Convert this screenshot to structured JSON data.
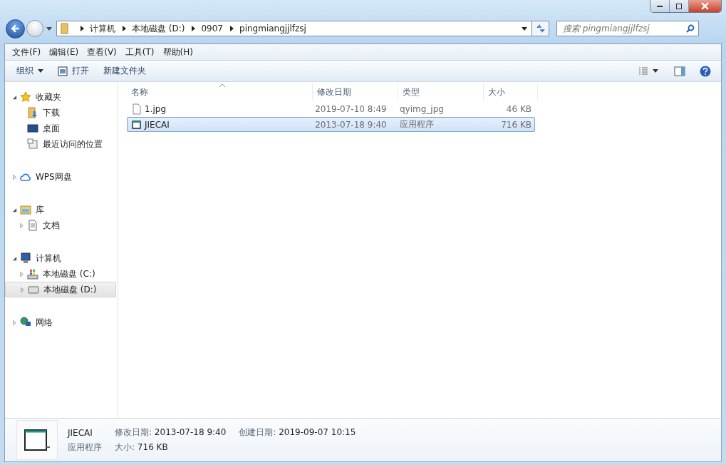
{
  "address": {
    "crumbs": [
      "计算机",
      "本地磁盘 (D:)",
      "0907",
      "pingmiangjjlfzsj"
    ]
  },
  "search": {
    "placeholder": "搜索 pingmiangjjlfzsj"
  },
  "menu": [
    "文件(F)",
    "编辑(E)",
    "查看(V)",
    "工具(T)",
    "帮助(H)"
  ],
  "toolbar": {
    "organize": "组织",
    "open": "打开",
    "new_folder": "新建文件夹"
  },
  "sidebar": {
    "items": [
      {
        "label": "收藏夹",
        "kind": "star",
        "expanded": true,
        "selected": false,
        "children": [
          {
            "label": "下载",
            "kind": "download",
            "selected": false
          },
          {
            "label": "桌面",
            "kind": "desktop",
            "selected": false
          },
          {
            "label": "最近访问的位置",
            "kind": "recent",
            "selected": false
          }
        ]
      },
      {
        "label": "WPS网盘",
        "kind": "cloud",
        "expanded": false,
        "selected": false
      },
      {
        "label": "库",
        "kind": "library",
        "expanded": true,
        "selected": false,
        "children": [
          {
            "label": "文档",
            "kind": "document",
            "expanded": false,
            "selected": false
          }
        ]
      },
      {
        "label": "计算机",
        "kind": "computer",
        "expanded": true,
        "selected": false,
        "children": [
          {
            "label": "本地磁盘 (C:)",
            "kind": "system-drive",
            "expanded": false,
            "selected": false
          },
          {
            "label": "本地磁盘 (D:)",
            "kind": "drive",
            "expanded": false,
            "selected": true
          }
        ]
      },
      {
        "label": "网络",
        "kind": "network",
        "expanded": false,
        "selected": false
      }
    ]
  },
  "table": {
    "columns": [
      {
        "label": "名称",
        "sorted": true
      },
      {
        "label": "修改日期",
        "sorted": false
      },
      {
        "label": "类型",
        "sorted": false
      },
      {
        "label": "大小",
        "sorted": false
      }
    ],
    "rows": [
      {
        "name": "1.jpg",
        "kind": "image",
        "modified": "2019-07-10 8:49",
        "type": "qyimg_jpg",
        "size": "46 KB",
        "selected": false
      },
      {
        "name": "JIECAI",
        "kind": "app",
        "modified": "2013-07-18 9:40",
        "type": "应用程序",
        "size": "716 KB",
        "selected": true
      }
    ]
  },
  "details": {
    "name": "JIECAI",
    "type": "应用程序",
    "fields": [
      {
        "label": "修改日期:",
        "value": "2013-07-18 9:40"
      },
      {
        "label": "大小:",
        "value": "716 KB"
      },
      {
        "label": "创建日期:",
        "value": "2019-09-07 10:15"
      }
    ]
  }
}
